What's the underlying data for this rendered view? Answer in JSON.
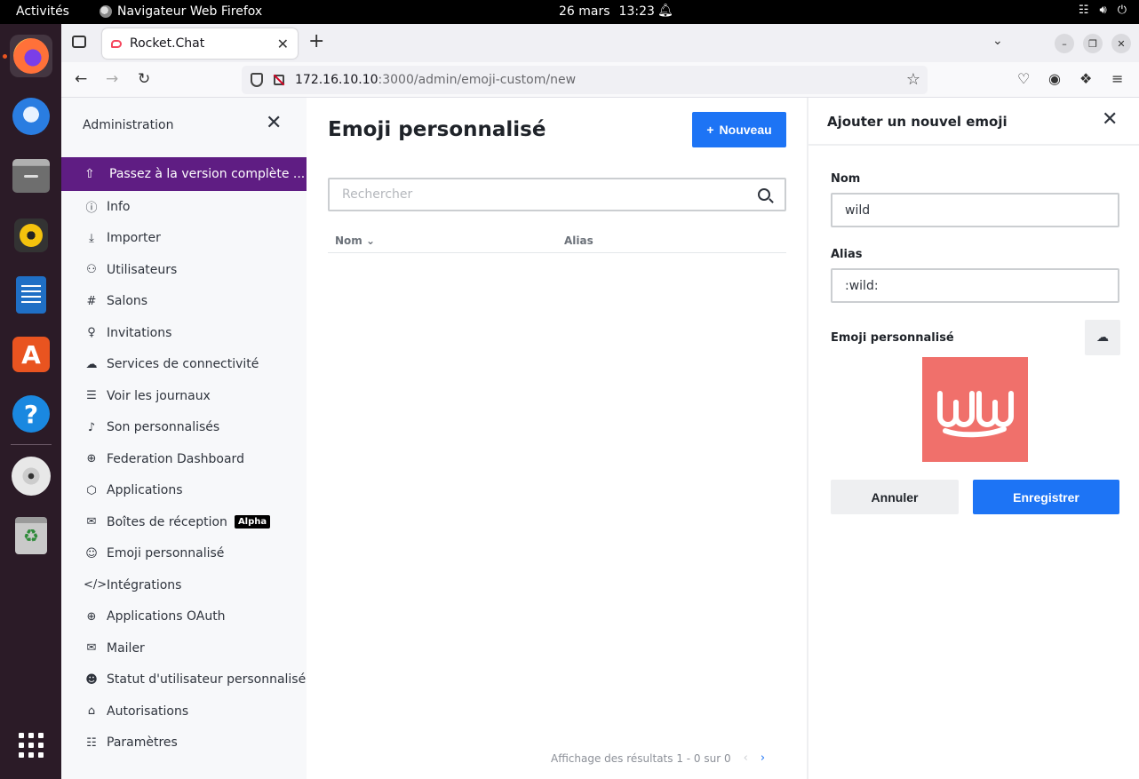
{
  "system_bar": {
    "activities": "Activités",
    "app_name": "Navigateur Web Firefox",
    "date": "26 mars",
    "time": "13:23"
  },
  "dock": {
    "apps": [
      "firefox",
      "thunderbird",
      "files",
      "rhythmbox",
      "libreoffice-writer",
      "app-center",
      "help",
      "disc",
      "trash",
      "show-apps"
    ]
  },
  "browser": {
    "tab_title": "Rocket.Chat",
    "url_host": "172.16.10.10",
    "url_path": ":3000/admin/emoji-custom/new"
  },
  "sidebar": {
    "title": "Administration",
    "upgrade_label": "Passez à la version complète ...",
    "items": [
      {
        "label": "Info",
        "icon": "info-icon"
      },
      {
        "label": "Importer",
        "icon": "import-icon"
      },
      {
        "label": "Utilisateurs",
        "icon": "users-icon"
      },
      {
        "label": "Salons",
        "icon": "hashtag-icon"
      },
      {
        "label": "Invitations",
        "icon": "user-plus-icon"
      },
      {
        "label": "Services de connectivité",
        "icon": "cloud-icon"
      },
      {
        "label": "Voir les journaux",
        "icon": "document-icon"
      },
      {
        "label": "Son personnalisés",
        "icon": "sound-icon"
      },
      {
        "label": "Federation Dashboard",
        "icon": "globe-icon"
      },
      {
        "label": "Applications",
        "icon": "cube-icon"
      },
      {
        "label": "Boîtes de réception",
        "icon": "mail-icon",
        "badge": "Alpha"
      },
      {
        "label": "Emoji personnalisé",
        "icon": "emoji-icon"
      },
      {
        "label": "Intégrations",
        "icon": "code-icon"
      },
      {
        "label": "Applications OAuth",
        "icon": "globe-icon"
      },
      {
        "label": "Mailer",
        "icon": "mail-icon"
      },
      {
        "label": "Statut d'utilisateur personnalisé",
        "icon": "user-icon"
      },
      {
        "label": "Autorisations",
        "icon": "lock-icon"
      },
      {
        "label": "Paramètres",
        "icon": "sliders-icon"
      }
    ]
  },
  "main": {
    "title": "Emoji personnalisé",
    "new_button": "Nouveau",
    "search_placeholder": "Rechercher",
    "columns": [
      "Nom",
      "Alias"
    ],
    "pagination_text": "Affichage des résultats 1 - 0 sur 0"
  },
  "panel": {
    "title": "Ajouter un nouvel emoji",
    "name_label": "Nom",
    "name_value": "wild",
    "alias_label": "Alias",
    "alias_value": ":wild:",
    "emoji_label": "Emoji personnalisé",
    "cancel_label": "Annuler",
    "save_label": "Enregistrer"
  },
  "colors": {
    "accent": "#1d74f5",
    "upgrade": "#5f1d83",
    "emoji_bg": "#f0706b"
  }
}
